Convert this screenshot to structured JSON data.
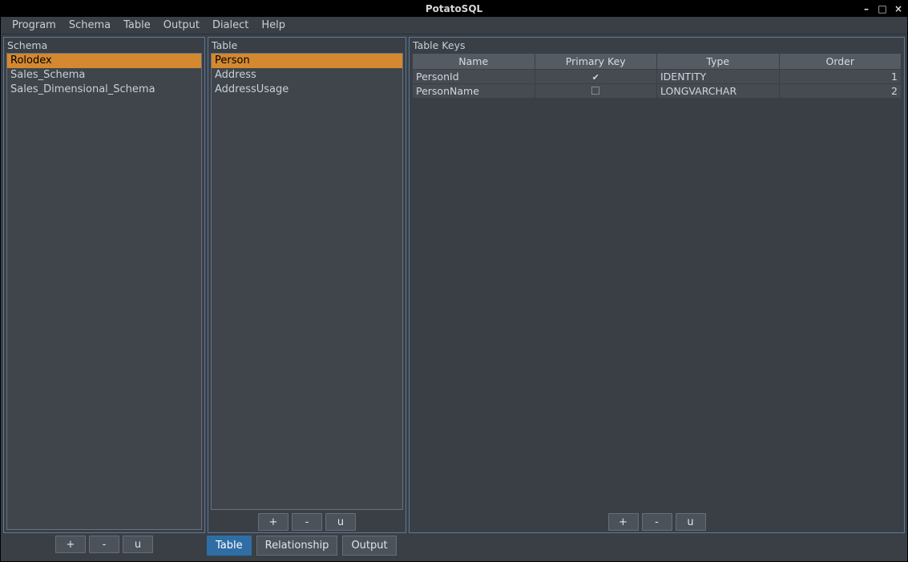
{
  "window": {
    "title": "PotatoSQL"
  },
  "menu": {
    "items": [
      {
        "label": "Program"
      },
      {
        "label": "Schema"
      },
      {
        "label": "Table"
      },
      {
        "label": "Output"
      },
      {
        "label": "Dialect"
      },
      {
        "label": "Help"
      }
    ]
  },
  "schema_panel": {
    "title": "Schema",
    "items": [
      {
        "label": "Rolodex",
        "selected": true
      },
      {
        "label": "Sales_Schema",
        "selected": false
      },
      {
        "label": "Sales_Dimensional_Schema",
        "selected": false
      }
    ],
    "buttons": {
      "add": "+",
      "remove": "-",
      "update": "u"
    }
  },
  "table_panel": {
    "title": "Table",
    "items": [
      {
        "label": "Person",
        "selected": true
      },
      {
        "label": "Address",
        "selected": false
      },
      {
        "label": "AddressUsage",
        "selected": false
      }
    ],
    "buttons": {
      "add": "+",
      "remove": "-",
      "update": "u"
    }
  },
  "keys_panel": {
    "title": "Table Keys",
    "columns": [
      {
        "label": "Name"
      },
      {
        "label": "Primary Key"
      },
      {
        "label": "Type"
      },
      {
        "label": "Order"
      }
    ],
    "rows": [
      {
        "name": "PersonId",
        "primary": true,
        "type": "IDENTITY",
        "order": "1"
      },
      {
        "name": "PersonName",
        "primary": false,
        "type": "LONGVARCHAR",
        "order": "2"
      }
    ],
    "buttons": {
      "add": "+",
      "remove": "-",
      "update": "u"
    }
  },
  "tabs": {
    "items": [
      {
        "label": "Table",
        "active": true
      },
      {
        "label": "Relationship",
        "active": false
      },
      {
        "label": "Output",
        "active": false
      }
    ]
  },
  "icons": {
    "minimize": "–",
    "maximize": "□",
    "close": "×",
    "check_on": "✔"
  }
}
